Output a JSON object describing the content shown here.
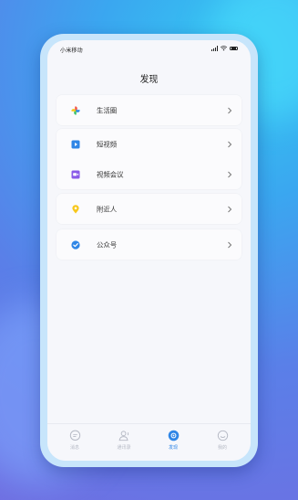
{
  "status_bar": {
    "carrier": "小米移动"
  },
  "header": {
    "title": "发现"
  },
  "menu": {
    "groups": [
      {
        "items": [
          {
            "label": "生活圈",
            "icon": "pinwheel-icon"
          }
        ]
      },
      {
        "items": [
          {
            "label": "短视频",
            "icon": "video-play-icon"
          },
          {
            "label": "视频会议",
            "icon": "video-meeting-icon"
          }
        ]
      },
      {
        "items": [
          {
            "label": "附近人",
            "icon": "location-pin-icon"
          }
        ]
      },
      {
        "items": [
          {
            "label": "公众号",
            "icon": "verified-badge-icon"
          }
        ]
      }
    ]
  },
  "tabbar": {
    "tabs": [
      {
        "label": "消息",
        "icon": "chat-bubble-icon",
        "active": false
      },
      {
        "label": "通讯录",
        "icon": "contacts-icon",
        "active": false
      },
      {
        "label": "发现",
        "icon": "discover-icon",
        "active": true
      },
      {
        "label": "我的",
        "icon": "profile-face-icon",
        "active": false
      }
    ]
  },
  "colors": {
    "accent": "#2f86e6",
    "video_blue": "#2f86e6",
    "meeting_purple": "#8a5be8",
    "pin_yellow": "#f7c71c",
    "badge_blue": "#2f86e6"
  }
}
